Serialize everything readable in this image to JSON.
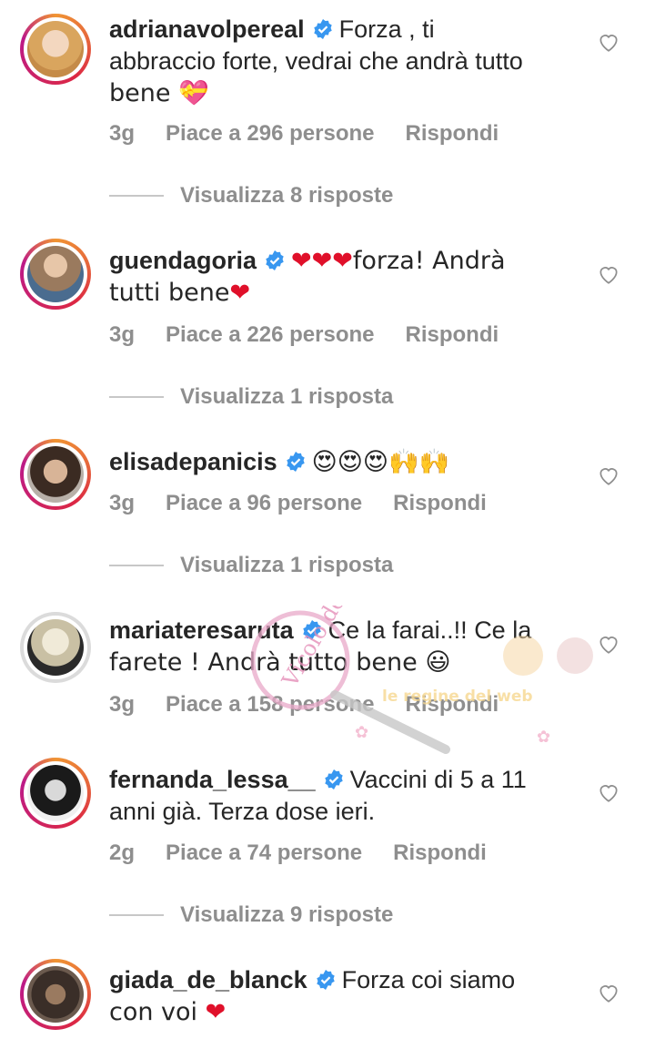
{
  "comments": [
    {
      "username": "adrianavolpereal",
      "text_line1": "Forza , ti",
      "text_line2": "abbraccio forte, vedrai che andrà tutto",
      "text_line3": "bene 💝",
      "time": "3g",
      "likes": "Piace a 296 persone",
      "reply": "Rispondi",
      "view_replies": "Visualizza 8 risposte"
    },
    {
      "username": "guendagoria",
      "text_line1": "❤❤❤forza! Andrà",
      "text_line2": "tutti bene❤",
      "time": "3g",
      "likes": "Piace a 226 persone",
      "reply": "Rispondi",
      "view_replies": "Visualizza 1 risposta"
    },
    {
      "username": "elisadepanicis",
      "text_line1": "😍😍😍🙌🙌",
      "time": "3g",
      "likes": "Piace a 96 persone",
      "reply": "Rispondi",
      "view_replies": "Visualizza 1 risposta"
    },
    {
      "username": "mariateresaruta",
      "text_line1": "Ce la farai..!! Ce la",
      "text_line2": "farete ! Andrà tutto bene 😃",
      "time": "3g",
      "likes": "Piace a 158 persone",
      "reply": "Rispondi"
    },
    {
      "username": "fernanda_lessa__",
      "text_line1": "Vaccini di 5 a 11",
      "text_line2": "anni già. Terza dose ieri.",
      "time": "2g",
      "likes": "Piace a 74 persone",
      "reply": "Rispondi",
      "view_replies": "Visualizza 9 risposte"
    },
    {
      "username": "giada_de_blanck",
      "text_line1": "Forza coi siamo",
      "text_line2": "con voi ❤"
    }
  ],
  "watermark": {
    "logo_text": "Vicolo delle News",
    "tagline": "le regine del web"
  },
  "colors": {
    "verified": "#3897f0",
    "meta": "#8e8e8e",
    "text": "#262626",
    "heart_red": "#e0102a"
  }
}
